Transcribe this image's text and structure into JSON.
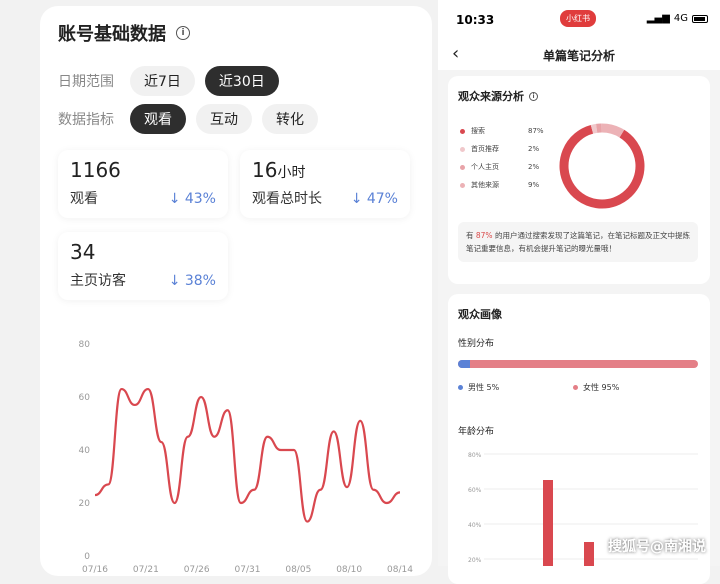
{
  "left": {
    "title": "账号基础数据",
    "date_label": "日期范围",
    "date_chips": [
      "近7日",
      "近30日"
    ],
    "metric_label": "数据指标",
    "metric_chips": [
      "观看",
      "互动",
      "转化"
    ],
    "cards": [
      {
        "value": "1166",
        "unit": "",
        "label": "观看",
        "change": "↓ 43%"
      },
      {
        "value": "16",
        "unit": "小时",
        "label": "观看总时长",
        "change": "↓ 47%"
      },
      {
        "value": "34",
        "unit": "",
        "label": "主页访客",
        "change": "↓ 38%"
      }
    ]
  },
  "chart_data": {
    "type": "line",
    "title": "",
    "xlabel": "",
    "ylabel": "",
    "ylim": [
      0,
      80
    ],
    "yticks": [
      0,
      20,
      40,
      60,
      80
    ],
    "xticks": [
      "07/16",
      "07/21",
      "07/26",
      "07/31",
      "08/05",
      "08/10",
      "08/14"
    ],
    "x_start": "07/16",
    "x_end": "08/14",
    "color": "#d9484f",
    "values": [
      23,
      27,
      63,
      57,
      63,
      43,
      20,
      45,
      60,
      45,
      55,
      20,
      25,
      45,
      40,
      40,
      13,
      25,
      47,
      26,
      51,
      25,
      20,
      24
    ]
  },
  "right": {
    "status": {
      "time": "10:33",
      "pill": "小红书",
      "network": "4G"
    },
    "nav_title": "单篇笔记分析",
    "source": {
      "title": "观众来源分析",
      "items": [
        {
          "name": "搜索",
          "pct": "87%",
          "color": "#d9484f",
          "value": 87
        },
        {
          "name": "首页推荐",
          "pct": "2%",
          "color": "#f0c8cb",
          "value": 2
        },
        {
          "name": "个人主页",
          "pct": "2%",
          "color": "#e8a3a8",
          "value": 2
        },
        {
          "name": "其他来源",
          "pct": "9%",
          "color": "#ecb2b6",
          "value": 9
        }
      ],
      "note_pre": "有",
      "note_hl": "87%",
      "note_post": "的用户通过搜索发现了这篇笔记，在笔记标题及正文中提炼笔记重要信息，有机会提升笔记的曝光量哦！"
    },
    "portrait": {
      "title": "观众画像",
      "gender_title": "性别分布",
      "male": "男性  5%",
      "female": "女性  95%",
      "male_share": 0.05,
      "age_title": "年龄分布",
      "age_ticks": [
        "80%",
        "60%",
        "40%",
        "20%"
      ]
    }
  },
  "watermark": "搜狐号@南湘说"
}
